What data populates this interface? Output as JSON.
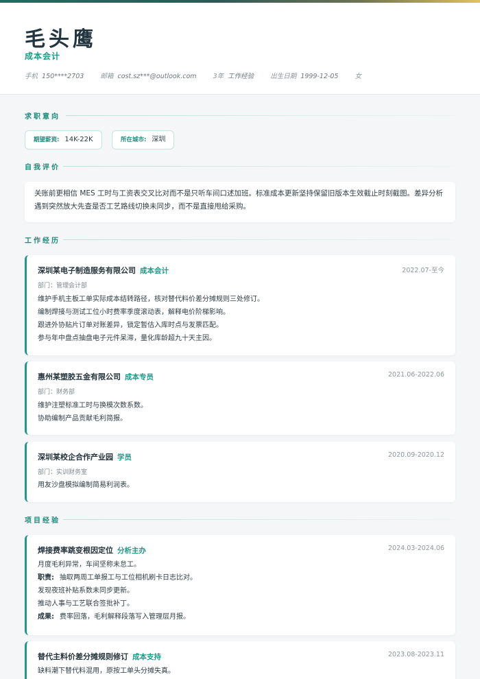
{
  "profile": {
    "name": "毛头鹰",
    "title": "成本会计",
    "phone_label": "手机",
    "phone": "150****2703",
    "email_label": "邮箱",
    "email": "cost.sz***@outlook.com",
    "exp_years": "3年",
    "exp_label": "工作经验",
    "birth_label": "出生日期",
    "birth": "1999-12-05",
    "gender": "女"
  },
  "sections": {
    "intent": "求职意向",
    "summary": "自我评价",
    "work": "工作经历",
    "projects": "项目经验"
  },
  "intent": {
    "salary_label": "期望薪资:",
    "salary": "14K-22K",
    "city_label": "所在城市:",
    "city": "深圳"
  },
  "summary": {
    "line1": "关账前更相信 MES 工时与工资表交叉比对而不是只听车间口述加班。标准成本更新坚持保留旧版本生效截止时刻截图。差异分析",
    "line2": "遇到突然放大先查是否工艺路线切换未同步，而不是直接甩给采购。"
  },
  "work": [
    {
      "company": "深圳某电子制造服务有限公司",
      "position": "成本会计",
      "date": "2022.07-至今",
      "dept": "部门：管理会计部",
      "bullets": [
        "维护手机主板工单实际成本结转路径，核对替代料价差分摊规则三处修订。",
        "编制焊接与测试工位小时费率季度滚动表，解释电价阶梯影响。",
        "跟进外协贴片订单对账差异，锁定暂估入库时点与发票匹配。",
        "参与年中盘点抽盘电子元件呆滞，量化库龄超九十天主因。"
      ]
    },
    {
      "company": "惠州某塑胶五金有限公司",
      "position": "成本专员",
      "date": "2021.06-2022.06",
      "dept": "部门：财务部",
      "bullets": [
        "维护注塑标准工时与换模次数系数。",
        "协助编制产品贡献毛利简报。"
      ]
    },
    {
      "company": "深圳某校企合作产业园",
      "position": "学员",
      "date": "2020.09-2020.12",
      "dept": "部门：实训财务室",
      "bullets": [
        "用友沙盘模拟编制简易利润表。"
      ]
    }
  ],
  "projects": [
    {
      "name": "焊接费率跳变根因定位",
      "role": "分析主办",
      "date": "2024.03-2024.06",
      "desc": "月度毛利异常，车间坚称未怠工。",
      "duty_label": "职责:",
      "duties": [
        "抽取两周工单报工与工位相机刷卡日志比对。",
        "发现夜班补贴系数未同步更新。",
        "推动人事与工艺联合签批补丁。"
      ],
      "result_label": "成果:",
      "result": "费率回落，毛利解释段落写入管理层月报。"
    },
    {
      "name": "替代主料价差分摊规则修订",
      "role": "成本支持",
      "date": "2023.08-2023.11",
      "desc": "缺料潮下替代料混用，原按工单头分摊失真。"
    }
  ],
  "colors": {
    "accent": "#1e9a86",
    "heading": "#233640",
    "background": "#f4f6f7"
  }
}
